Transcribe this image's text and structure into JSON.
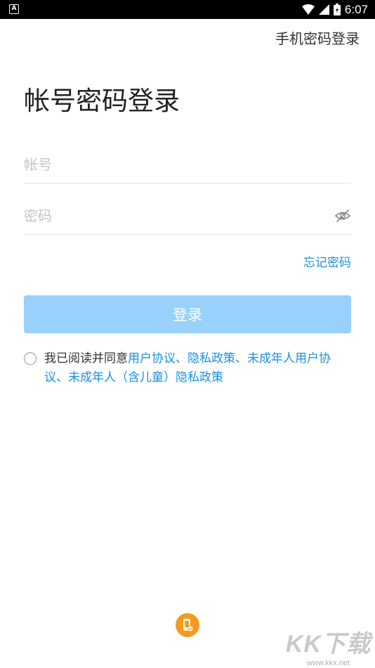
{
  "status_bar": {
    "time": "6:07",
    "app_badge": "A"
  },
  "header": {
    "switch_link": "手机密码登录"
  },
  "page_title": "帐号密码登录",
  "form": {
    "account_placeholder": "帐号",
    "password_placeholder": "密码",
    "forgot_label": "忘记密码",
    "login_label": "登录"
  },
  "agreement": {
    "prefix": "我已阅读并同意",
    "user_agreement": "用户协议",
    "sep1": "、",
    "privacy_policy": "隐私政策",
    "sep2": "、",
    "minor_user_agreement": "未成年人用户协议",
    "sep3": "、",
    "minor_privacy_policy": "未成年人（含儿童）隐私政策"
  },
  "watermark": {
    "main": "KK下载",
    "sub": "www.kkx.net"
  },
  "colors": {
    "accent": "#1b8fe0",
    "login_button": "#98d1fb",
    "bottom_icon": "#f59a1d"
  },
  "icons": {
    "eye": "eye-off-icon",
    "bottom": "phone-check-icon"
  }
}
